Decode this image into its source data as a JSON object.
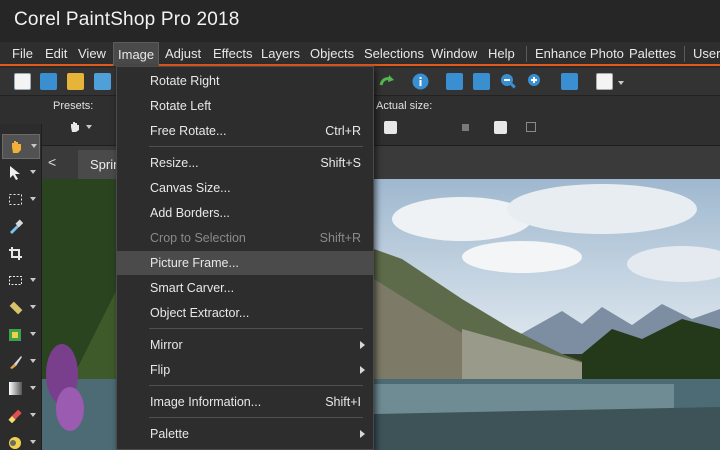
{
  "app": {
    "title": "Corel PaintShop Pro 2018"
  },
  "menubar": {
    "file": "File",
    "edit": "Edit",
    "view": "View",
    "image": "Image",
    "adjust": "Adjust",
    "effects": "Effects",
    "layers": "Layers",
    "objects": "Objects",
    "selections": "Selections",
    "window": "Window",
    "help": "Help",
    "enhance_photo": "Enhance Photo",
    "palettes": "Palettes",
    "user": "User"
  },
  "options": {
    "presets_label": "Presets:",
    "actual_size_label": "Actual size:"
  },
  "tabs": {
    "chevron": "<",
    "current_tab": "Sprin"
  },
  "image_menu": {
    "rotate_right": "Rotate Right",
    "rotate_left": "Rotate Left",
    "free_rotate": "Free Rotate...",
    "free_rotate_shortcut": "Ctrl+R",
    "resize": "Resize...",
    "resize_shortcut": "Shift+S",
    "canvas_size": "Canvas Size...",
    "add_borders": "Add Borders...",
    "crop_to_selection": "Crop to Selection",
    "crop_to_selection_shortcut": "Shift+R",
    "picture_frame": "Picture Frame...",
    "smart_carver": "Smart Carver...",
    "object_extractor": "Object Extractor...",
    "mirror": "Mirror",
    "flip": "Flip",
    "image_information": "Image Information...",
    "image_information_shortcut": "Shift+I",
    "palette": "Palette"
  },
  "colors": {
    "accent": "#e05a1e",
    "highlight": "#4b4b4b",
    "menu_bg": "#2d2d2d"
  },
  "icons": {
    "toolbar": [
      "new-document-icon",
      "browse-grid-icon",
      "open-folder-icon",
      "scan-icon",
      "redo-icon",
      "info-icon",
      "fit-window-icon",
      "fit-image-icon",
      "zoom-out-icon",
      "zoom-in-icon",
      "add-icon",
      "copy-icon"
    ],
    "tools": [
      "pan-hand-icon",
      "pick-arrow-icon",
      "selection-rect-icon",
      "eyedropper-icon",
      "crop-icon",
      "straighten-icon",
      "tape-measure-icon",
      "clone-icon",
      "paint-brush-icon",
      "gradient-icon",
      "eraser-icon",
      "fill-icon"
    ]
  }
}
